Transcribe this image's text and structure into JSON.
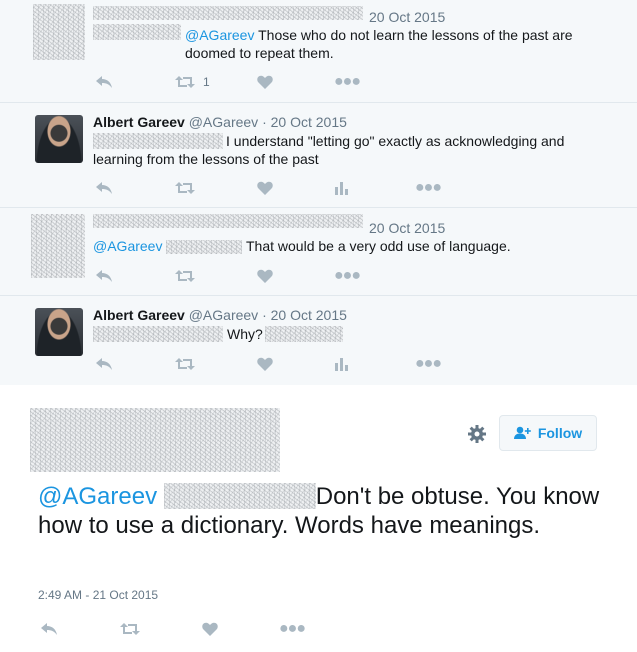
{
  "replies": [
    {
      "time": "20 Oct 2015",
      "mention": "@AGareev",
      "text": " Those who do not learn the lessons of the past are doomed to repeat them.",
      "retweet_count": "1"
    },
    {
      "name": "Albert Gareev",
      "handle": "@AGareev",
      "time": "20 Oct 2015",
      "text": "I understand \"letting go\" exactly as acknowledging and learning from the lessons of the past"
    },
    {
      "time": "20 Oct 2015",
      "mention": "@AGareev",
      "text": "That would be a very odd use of language."
    },
    {
      "name": "Albert Gareev",
      "handle": "@AGareev",
      "time": "20 Oct 2015",
      "text": "Why?"
    }
  ],
  "main_tweet": {
    "follow_label": "Follow",
    "mention": "@AGareev",
    "text": "Don't be obtuse. You know how to use a dictionary. Words have meanings.",
    "timestamp": "2:49 AM - 21 Oct 2015"
  },
  "icons": {
    "reply": "reply-icon",
    "retweet": "retweet-icon",
    "like": "heart-icon",
    "analytics": "analytics-icon",
    "more": "more-icon",
    "settings": "gear-icon",
    "follow": "add-user-icon"
  },
  "colors": {
    "link": "#1b95e0",
    "muted": "#657786",
    "icon": "#aab8c2",
    "reply_bg": "#f5f8fa"
  }
}
